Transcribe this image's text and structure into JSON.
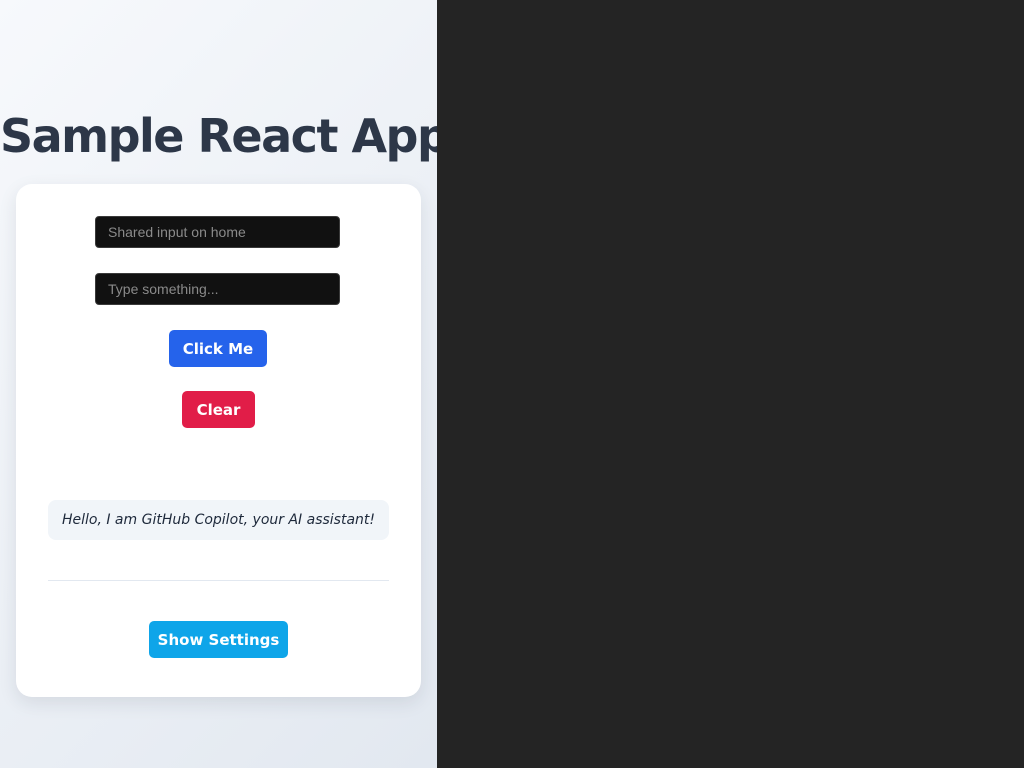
{
  "app": {
    "title": "Sample React App"
  },
  "inputs": {
    "shared": {
      "value": "",
      "placeholder": "Shared input on home"
    },
    "main": {
      "value": "",
      "placeholder": "Type something..."
    }
  },
  "buttons": {
    "click_label": "Click Me",
    "clear_label": "Clear",
    "settings_label": "Show Settings"
  },
  "message": {
    "text": "Hello, I am GitHub Copilot, your AI assistant!"
  },
  "colors": {
    "page_background": "#242424",
    "title_text": "#2d3748",
    "primary_button": "#2563eb",
    "danger_button": "#e11d48",
    "info_button": "#0ea5e9",
    "input_background": "#111111"
  }
}
